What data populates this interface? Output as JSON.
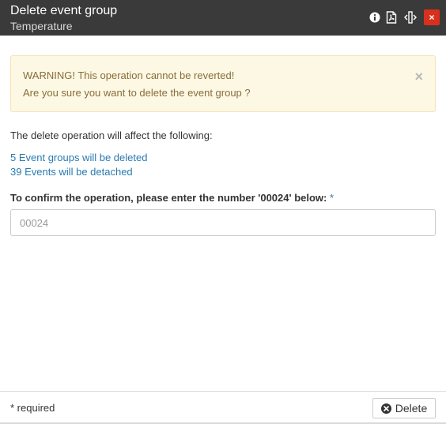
{
  "dialog": {
    "title": "Delete event group",
    "subtitle": "Temperature",
    "toolbar_icons": [
      "info-icon",
      "pdf-icon",
      "resize-icon",
      "close-icon"
    ],
    "close_glyph": "×"
  },
  "alert": {
    "line1": "WARNING! This operation cannot be reverted!",
    "line2": "Are you sure you want to delete the event group ?",
    "close_glyph": "×"
  },
  "effects": {
    "intro": "The delete operation will affect the following:",
    "event_groups_count": "5",
    "event_groups_text": " Event groups will be deleted",
    "events_count": "39",
    "events_text": " Events will be detached"
  },
  "confirm": {
    "label": "To confirm the operation, please enter the number '00024' below:",
    "required_marker": "*",
    "placeholder": "00024"
  },
  "footer": {
    "required_note": "* required",
    "delete_label": "Delete"
  },
  "colors": {
    "titlebar": "#3a3a3a",
    "close_red": "#d9301e",
    "alert_bg": "#fcf8e3",
    "alert_text": "#8a6d3b",
    "link": "#2a7ab0"
  }
}
